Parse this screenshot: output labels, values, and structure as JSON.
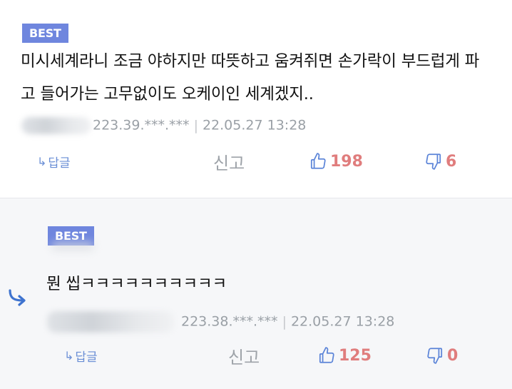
{
  "badge_text": "BEST",
  "comments": [
    {
      "content": "미시세계라니 조금 야하지만 따뜻하고 움켜쥐면 손가락이 부드럽게 파고 들어가는 고무없이도 오케이인 세계겠지..",
      "ip": "223.39.***.***",
      "date": "22.05.27 13:28",
      "reply_label": "답글",
      "report_label": "신고",
      "likes": "198",
      "dislikes": "6"
    },
    {
      "content": "뭔 씹ㅋㅋㅋㅋㅋㅋㅋㅋㅋㅋ",
      "ip": "223.38.***.***",
      "date": "22.05.27 13:28",
      "reply_label": "답글",
      "report_label": "신고",
      "likes": "125",
      "dislikes": "0"
    }
  ],
  "colors": {
    "badge": "#6f86de",
    "like_count": "#e07d7d",
    "icon_blue": "#5b84d8",
    "meta_gray": "#9aa0a6"
  },
  "icons": {
    "reply": "reply-arrow-icon",
    "like": "thumbs-up-icon",
    "dislike": "thumbs-down-icon",
    "nested": "nested-reply-arrow-icon"
  }
}
